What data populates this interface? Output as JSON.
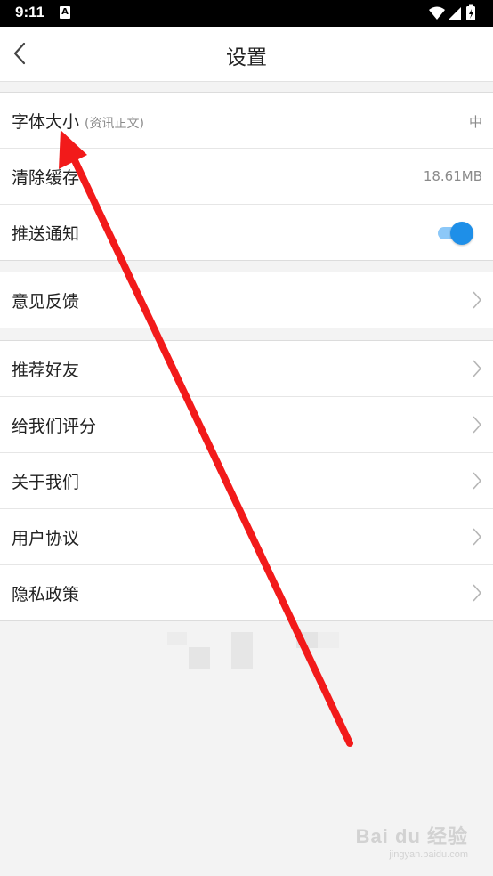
{
  "status_bar": {
    "time": "9:11",
    "notification_glyph": "A",
    "icons": [
      "wifi-icon",
      "signal-icon",
      "battery-icon"
    ]
  },
  "header": {
    "title": "设置",
    "back_icon": "chevron-left-icon"
  },
  "group_display": {
    "font_size": {
      "label": "字体大小",
      "sub": "(资讯正文)",
      "value": "中"
    },
    "clear_cache": {
      "label": "清除缓存",
      "value": "18.61MB"
    },
    "push": {
      "label": "推送通知",
      "enabled": true
    }
  },
  "group_feedback": {
    "feedback": {
      "label": "意见反馈"
    }
  },
  "group_more": {
    "items": [
      {
        "label": "推荐好友"
      },
      {
        "label": "给我们评分"
      },
      {
        "label": "关于我们"
      },
      {
        "label": "用户协议"
      },
      {
        "label": "隐私政策"
      }
    ]
  },
  "watermark": {
    "main": "Bai du 经验",
    "sub": "jingyan.baidu.com"
  },
  "colors": {
    "accent": "#1e8fe8",
    "accent_track": "#8cc8f8",
    "annotation_arrow": "#f21a1a"
  }
}
